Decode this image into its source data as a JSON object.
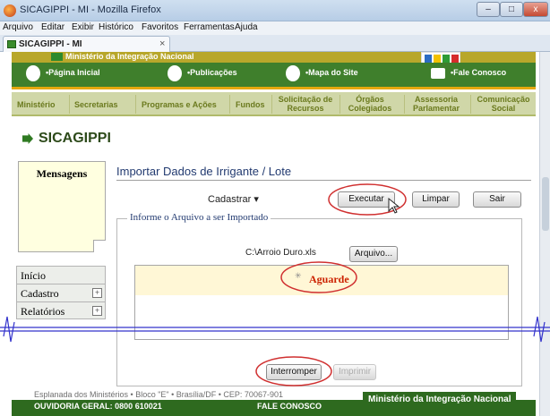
{
  "window": {
    "title": "SICAGIPPI - MI - Mozilla Firefox"
  },
  "menubar": [
    "Arquivo",
    "Editar",
    "Exibir",
    "Histórico",
    "Favoritos",
    "Ferramentas",
    "Ajuda"
  ],
  "tab": {
    "label": "SICAGIPPI - MI"
  },
  "gov": {
    "ministry": "Ministério da Integração Nacional"
  },
  "topnav": [
    "•Página Inicial",
    "•Publicações",
    "•Mapa do Site",
    "•Fale Conosco"
  ],
  "mainnav": [
    "Ministério",
    "Secretarias",
    "Programas e Ações",
    "Fundos",
    "Solicitação de Recursos",
    "Órgãos Colegiados",
    "Assessoria Parlamentar",
    "Comunicação Social"
  ],
  "brand": "SICAGIPPI",
  "messages": {
    "title": "Mensagens"
  },
  "sidemenu": [
    {
      "label": "Início"
    },
    {
      "label": "Cadastro"
    },
    {
      "label": "Relatórios"
    }
  ],
  "page": {
    "title": "Importar Dados de Irrigante / Lote"
  },
  "toolbar": {
    "cadastrar": "Cadastrar",
    "executar": "Executar",
    "limpar": "Limpar",
    "sair": "Sair"
  },
  "form": {
    "legend": "Informe o Arquivo a ser Importado",
    "file_path": "C:\\Arroio Duro.xls",
    "file_button": "Arquivo...",
    "status": "Aguarde",
    "interromper": "Interromper",
    "imprimir": "Imprimir"
  },
  "footer": {
    "address": "Esplanada dos Ministérios • Bloco \"E\" • Brasília/DF • CEP: 70067-901",
    "ouvidoria": "OUVIDORIA GERAL: 0800 610021",
    "fale": "FALE CONOSCO",
    "ministry": "Ministério da Integração Nacional"
  },
  "colors": {
    "accent_green": "#3f7f2c",
    "annotation_red": "#d03030",
    "cut_line": "#3333cc"
  }
}
